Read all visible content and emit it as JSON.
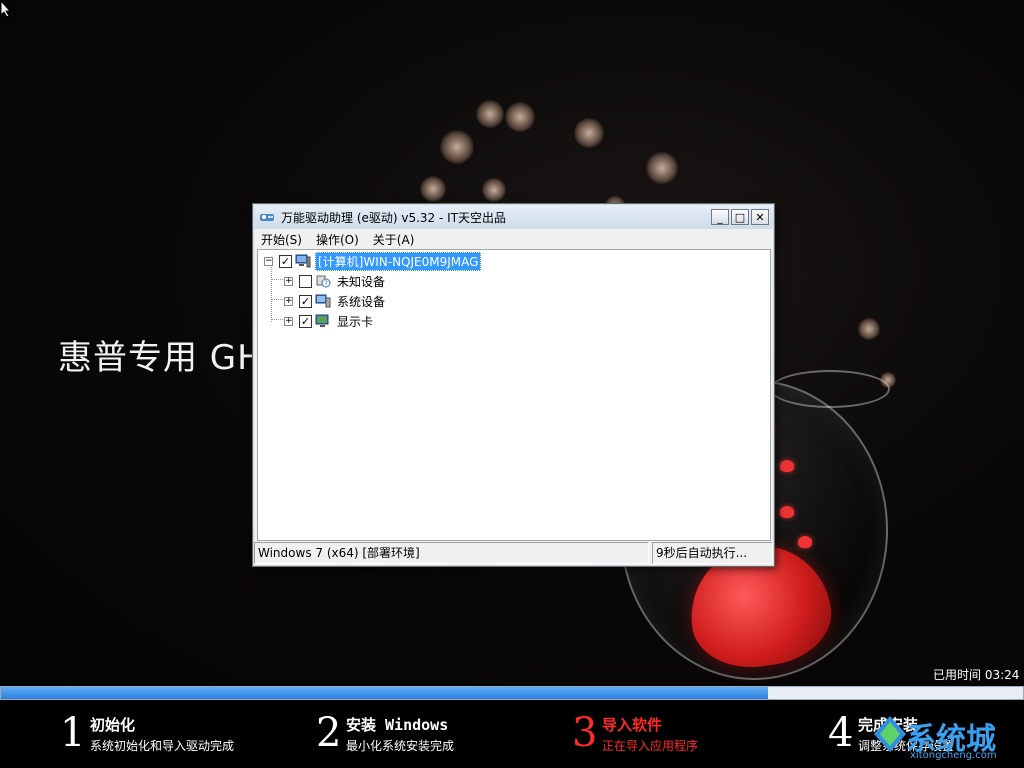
{
  "background": {
    "title": "惠普专用 GHO"
  },
  "window": {
    "title": "万能驱动助理 (e驱动) v5.32 - IT天空出品",
    "controls": {
      "minimize": "_",
      "maximize": "□",
      "close": "✕"
    },
    "menu": [
      "开始(S)",
      "操作(O)",
      "关于(A)"
    ],
    "tree": {
      "root": {
        "label": "[计算机]WIN-NQJE0M9JMAG",
        "checked": true,
        "selected": true
      },
      "children": [
        {
          "label": "未知设备",
          "checked": false,
          "icon": "unknown-device-icon"
        },
        {
          "label": "系统设备",
          "checked": true,
          "icon": "system-device-icon"
        },
        {
          "label": "显示卡",
          "checked": true,
          "icon": "display-card-icon"
        }
      ]
    },
    "status": {
      "left": "Windows 7 (x64) [部署环境]",
      "right": "9秒后自动执行..."
    }
  },
  "timer": {
    "label": "已用时间 03:24"
  },
  "progress": {
    "fraction": 0.75
  },
  "steps": [
    {
      "num": "1",
      "title": "初始化",
      "sub": "系统初始化和导入驱动完成",
      "active": false
    },
    {
      "num": "2",
      "title": "安装 Windows",
      "sub": "最小化系统安装完成",
      "active": false
    },
    {
      "num": "3",
      "title": "导入软件",
      "sub": "正在导入应用程序",
      "active": true
    },
    {
      "num": "4",
      "title": "完成安装",
      "sub": "调整系统保存设置",
      "active": false
    }
  ],
  "watermark": {
    "text": "系统城",
    "url": "xitongcheng.com"
  },
  "colors": {
    "active_step": "#ff2a2a",
    "progress_fill": "#2c7fe0",
    "selection": "#3399ff"
  }
}
